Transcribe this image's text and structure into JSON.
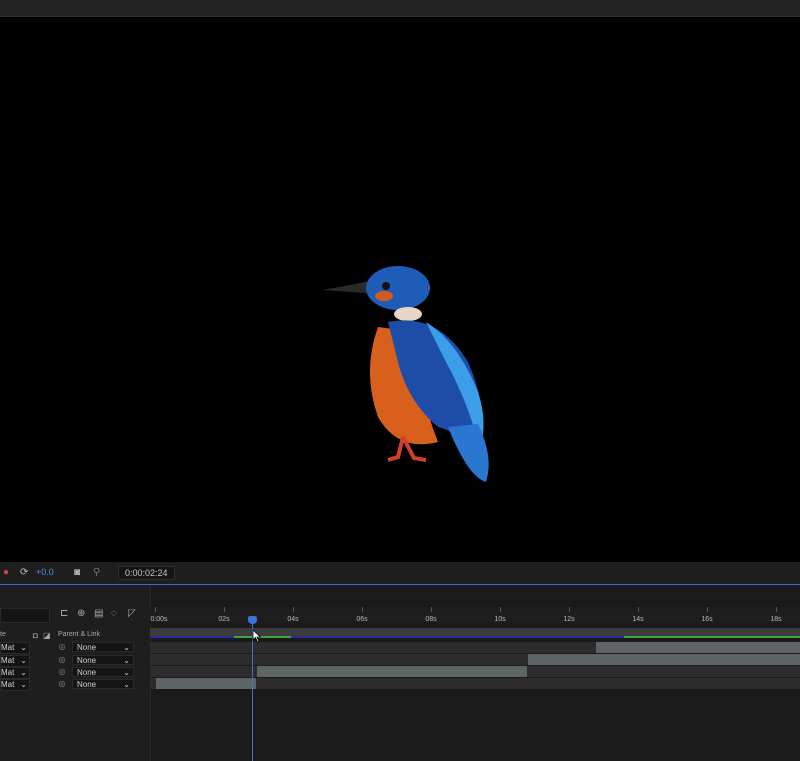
{
  "viewer": {
    "subject": "kingfisher-bird",
    "exposure": "+0.0",
    "timecode": "0:00:02:24"
  },
  "timeline": {
    "ruler_labels": [
      "0:00s",
      "02s",
      "04s",
      "06s",
      "08s",
      "10s",
      "12s",
      "14s",
      "16s",
      "18s"
    ],
    "columns": {
      "trkmat": "te",
      "parent": "Parent & Link"
    },
    "layers": [
      {
        "matte": "Mat",
        "parent": "None"
      },
      {
        "matte": "Mat",
        "parent": "None"
      },
      {
        "matte": "Mat",
        "parent": "None"
      },
      {
        "matte": "Mat",
        "parent": "None"
      }
    ]
  },
  "colors": {
    "accent": "#3a72d8",
    "exposure": "#4c8fe8",
    "render_bar": "#3aa83a"
  }
}
